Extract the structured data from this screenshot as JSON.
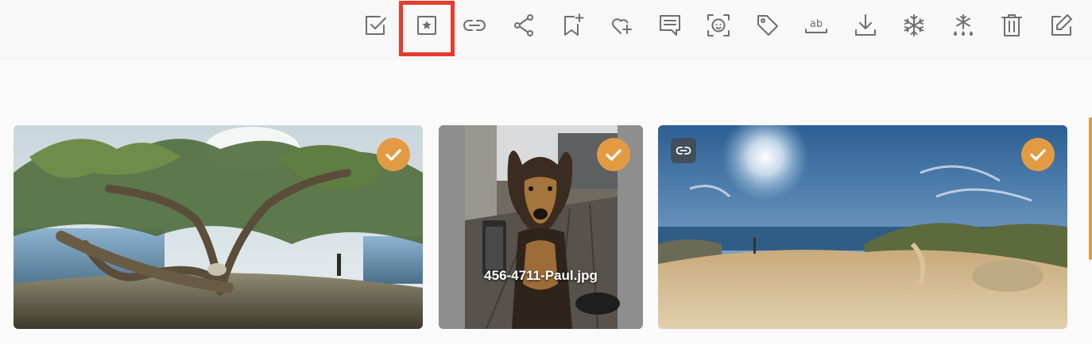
{
  "toolbar": {
    "buttons": [
      {
        "name": "select-icon",
        "title": "Select"
      },
      {
        "name": "favorite-icon",
        "title": "Favorite",
        "highlighted": true
      },
      {
        "name": "link-icon",
        "title": "Link"
      },
      {
        "name": "share-icon",
        "title": "Share"
      },
      {
        "name": "bookmark-add-icon",
        "title": "Add to album"
      },
      {
        "name": "heart-add-icon",
        "title": "Like"
      },
      {
        "name": "comment-icon",
        "title": "Comment"
      },
      {
        "name": "face-icon",
        "title": "Faces"
      },
      {
        "name": "tag-icon",
        "title": "Label"
      },
      {
        "name": "rename-icon",
        "title": "Rename"
      },
      {
        "name": "download-icon",
        "title": "Download"
      },
      {
        "name": "snowflake-icon",
        "title": "Freeze"
      },
      {
        "name": "snowflake-drops-icon",
        "title": "Unfreeze"
      },
      {
        "name": "trash-icon",
        "title": "Delete"
      },
      {
        "name": "edit-icon",
        "title": "Edit"
      }
    ],
    "rename_icon_text": "ab",
    "highlight_color": "#e63b2e"
  },
  "cards": [
    {
      "name": "photo-card-tree-panorama",
      "selected": true,
      "linked": false,
      "caption": ""
    },
    {
      "name": "photo-card-dog",
      "selected": true,
      "linked": false,
      "caption": "456-4711-Paul.jpg"
    },
    {
      "name": "photo-card-coast-panorama",
      "selected": true,
      "linked": true,
      "caption": ""
    }
  ],
  "colors": {
    "accent": "#e39b43",
    "icon": "#6e6e6e",
    "background": "#fafafa"
  }
}
